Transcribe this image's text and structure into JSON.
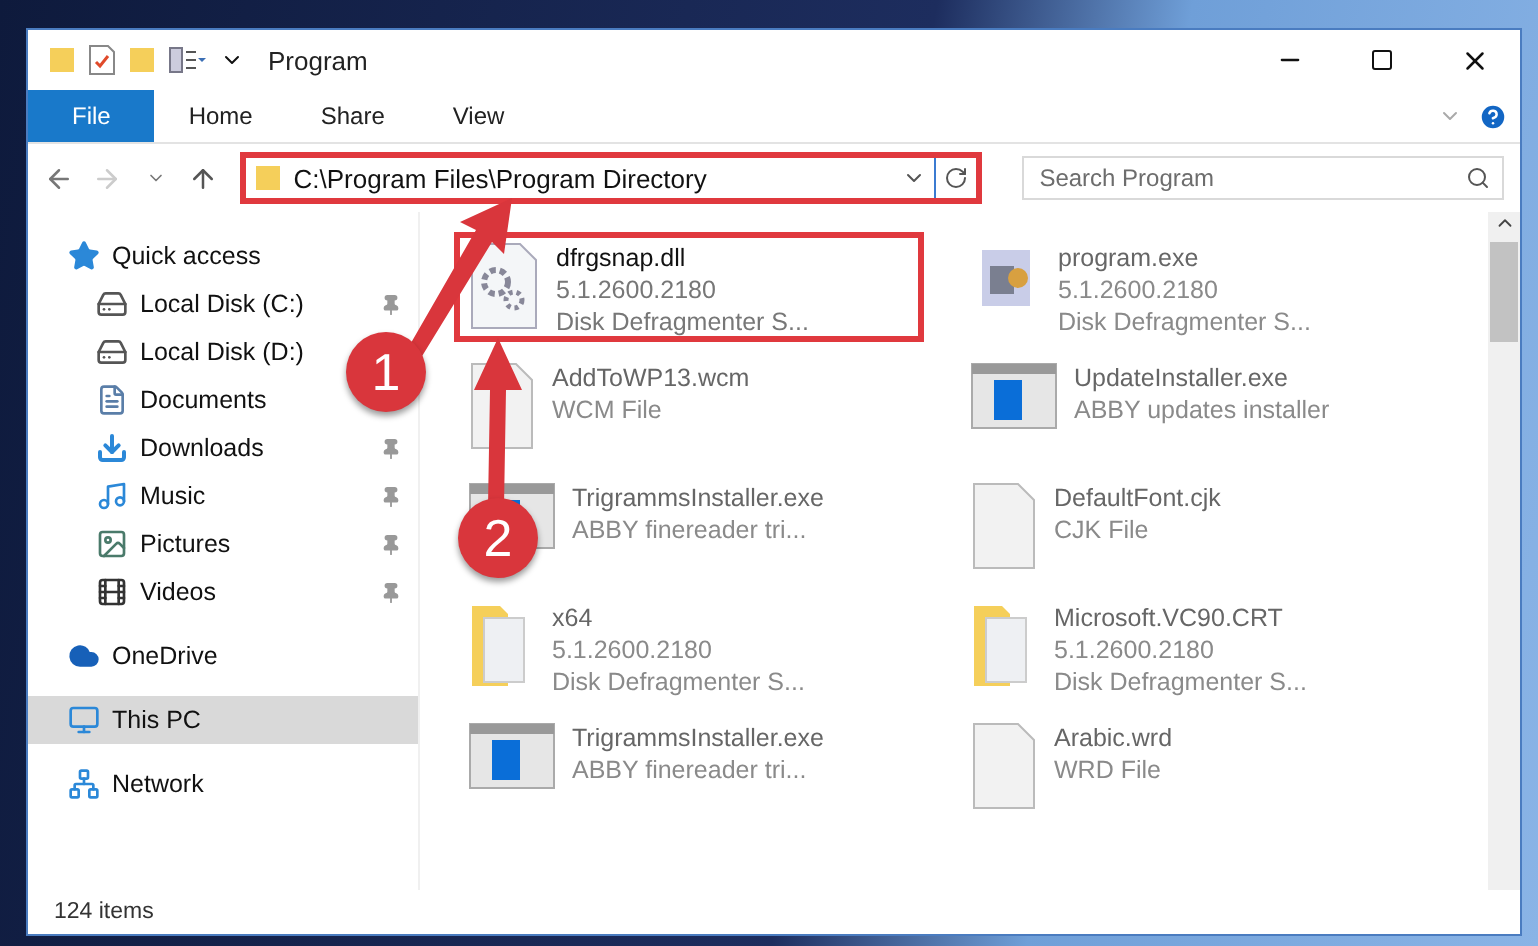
{
  "window": {
    "title": "Program"
  },
  "ribbon_tabs": [
    {
      "label": "File",
      "selected": true
    },
    {
      "label": "Home",
      "selected": false
    },
    {
      "label": "Share",
      "selected": false
    },
    {
      "label": "View",
      "selected": false
    }
  ],
  "address": {
    "value": "C:\\Program Files\\Program Directory",
    "highlighted": true
  },
  "search": {
    "placeholder": "Search Program"
  },
  "sidebar": {
    "items": [
      {
        "label": "Quick access",
        "kind": "star",
        "pinned": false,
        "selected": false,
        "children": [
          {
            "label": "Local Disk (C:)",
            "kind": "system-drive",
            "pinned": true,
            "selected": false
          },
          {
            "label": "Local Disk (D:)",
            "kind": "drive",
            "pinned": false,
            "selected": false
          },
          {
            "label": "Documents",
            "kind": "documents",
            "pinned": false,
            "selected": false
          },
          {
            "label": "Downloads",
            "kind": "downloads",
            "pinned": true,
            "selected": false
          },
          {
            "label": "Music",
            "kind": "music",
            "pinned": true,
            "selected": false
          },
          {
            "label": "Pictures",
            "kind": "pictures",
            "pinned": true,
            "selected": false
          },
          {
            "label": "Videos",
            "kind": "videos",
            "pinned": true,
            "selected": false
          }
        ]
      },
      {
        "label": "OneDrive",
        "kind": "cloud",
        "pinned": false,
        "selected": false
      },
      {
        "label": "This PC",
        "kind": "pc",
        "pinned": false,
        "selected": true
      },
      {
        "label": "Network",
        "kind": "network",
        "pinned": false,
        "selected": false
      }
    ]
  },
  "files": [
    {
      "name": "dfrgsnap.dll",
      "lines": [
        "5.1.2600.2180",
        "Disk Defragmenter S..."
      ],
      "kind": "gear-file",
      "highlighted": true
    },
    {
      "name": "program.exe",
      "lines": [
        "5.1.2600.2180",
        "Disk Defragmenter S..."
      ],
      "kind": "app",
      "highlighted": false
    },
    {
      "name": "AddToWP13.wcm",
      "lines": [
        "WCM File"
      ],
      "kind": "blank",
      "highlighted": false
    },
    {
      "name": "UpdateInstaller.exe",
      "lines": [
        "ABBY updates installer"
      ],
      "kind": "window",
      "highlighted": false
    },
    {
      "name": "TrigrammsInstaller.exe",
      "lines": [
        "ABBY finereader tri..."
      ],
      "kind": "window",
      "highlighted": false
    },
    {
      "name": "DefaultFont.cjk",
      "lines": [
        "CJK File"
      ],
      "kind": "blank",
      "highlighted": false
    },
    {
      "name": "x64",
      "lines": [
        "5.1.2600.2180",
        "Disk Defragmenter S..."
      ],
      "kind": "folder",
      "highlighted": false
    },
    {
      "name": "Microsoft.VC90.CRT",
      "lines": [
        "5.1.2600.2180",
        "Disk Defragmenter S..."
      ],
      "kind": "folder",
      "highlighted": false
    },
    {
      "name": "TrigrammsInstaller.exe",
      "lines": [
        "ABBY finereader tri..."
      ],
      "kind": "window",
      "highlighted": false
    },
    {
      "name": "Arabic.wrd",
      "lines": [
        "WRD File"
      ],
      "kind": "blank",
      "highlighted": false
    }
  ],
  "status_bar": {
    "count": "124 items"
  },
  "annotations": [
    {
      "number": "1"
    },
    {
      "number": "2"
    }
  ]
}
